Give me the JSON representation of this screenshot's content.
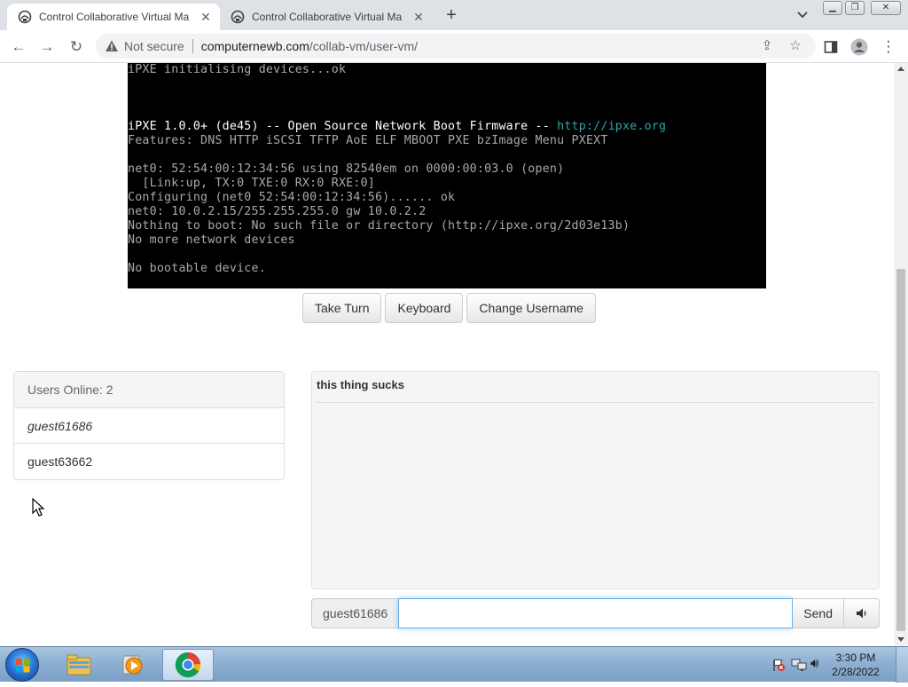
{
  "browser": {
    "tabs": [
      {
        "title": "Control Collaborative Virtual Ma",
        "active": true
      },
      {
        "title": "Control Collaborative Virtual Ma",
        "active": false
      }
    ],
    "address": {
      "security_label": "Not secure",
      "url_host": "computernewb.com",
      "url_path": "/collab-vm/user-vm/"
    }
  },
  "vm": {
    "screen_lines": [
      {
        "text": "iPXE initialising devices...ok",
        "style": "normal"
      },
      {
        "text": "",
        "style": "normal"
      },
      {
        "text": "",
        "style": "normal"
      },
      {
        "text": "",
        "style": "normal"
      },
      {
        "text": "iPXE 1.0.0+ (de45) -- Open Source Network Boot Firmware -- ",
        "style": "bright",
        "link": "http://ipxe.org"
      },
      {
        "text": "Features: DNS HTTP iSCSI TFTP AoE ELF MBOOT PXE bzImage Menu PXEXT",
        "style": "normal"
      },
      {
        "text": "",
        "style": "normal"
      },
      {
        "text": "net0: 52:54:00:12:34:56 using 82540em on 0000:00:03.0 (open)",
        "style": "normal"
      },
      {
        "text": "  [Link:up, TX:0 TXE:0 RX:0 RXE:0]",
        "style": "normal"
      },
      {
        "text": "Configuring (net0 52:54:00:12:34:56)...... ok",
        "style": "normal"
      },
      {
        "text": "net0: 10.0.2.15/255.255.255.0 gw 10.0.2.2",
        "style": "normal"
      },
      {
        "text": "Nothing to boot: No such file or directory (http://ipxe.org/2d03e13b)",
        "style": "normal"
      },
      {
        "text": "No more network devices",
        "style": "normal"
      },
      {
        "text": "",
        "style": "normal"
      },
      {
        "text": "No bootable device.",
        "style": "normal"
      }
    ],
    "buttons": {
      "take_turn": "Take Turn",
      "keyboard": "Keyboard",
      "change_username": "Change Username"
    }
  },
  "users": {
    "header": "Users Online: 2",
    "list": [
      {
        "name": "guest61686",
        "is_self": true
      },
      {
        "name": "guest63662",
        "is_self": false
      }
    ]
  },
  "chat": {
    "messages": [
      "this thing sucks"
    ],
    "username": "guest61686",
    "input_value": "",
    "send_label": "Send"
  },
  "taskbar": {
    "time": "3:30 PM",
    "date": "2/28/2022"
  },
  "colors": {
    "accent_input_focus": "#66afe9",
    "vm_link": "#2aa7a7",
    "tabstrip": "#dee1e6"
  }
}
